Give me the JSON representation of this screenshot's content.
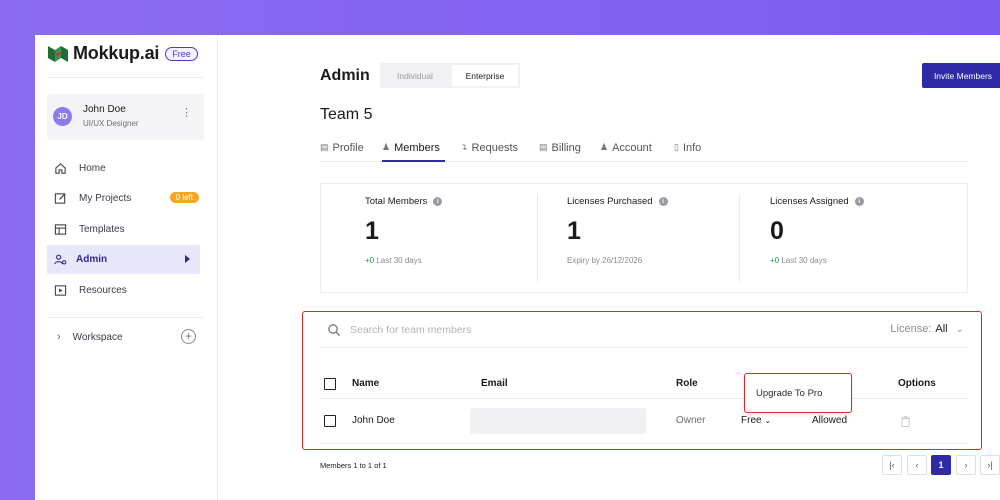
{
  "app": {
    "logo_text": "Mokkup.ai",
    "plan_badge": "Free"
  },
  "user": {
    "initials": "JD",
    "name": "John Doe",
    "role": "UI/UX Designer",
    "menu_icon": "kebab-icon"
  },
  "sidebar": {
    "items": [
      {
        "label": "Home",
        "icon": "home-icon"
      },
      {
        "label": "My Projects",
        "icon": "edit-icon",
        "badge": "0 left"
      },
      {
        "label": "Templates",
        "icon": "template-icon"
      },
      {
        "label": "Admin",
        "icon": "admin-icon",
        "active": true
      },
      {
        "label": "Resources",
        "icon": "play-box-icon"
      }
    ],
    "workspace_label": "Workspace"
  },
  "header": {
    "title": "Admin",
    "segments": [
      "Individual",
      "Enterprise"
    ],
    "selected_segment": "Enterprise",
    "invite_label": "Invite Members"
  },
  "team": {
    "title": "Team 5"
  },
  "tabs": [
    {
      "label": "Profile",
      "icon": "profile-icon"
    },
    {
      "label": "Members",
      "icon": "members-icon",
      "active": true
    },
    {
      "label": "Requests",
      "icon": "requests-icon"
    },
    {
      "label": "Billing",
      "icon": "billing-icon"
    },
    {
      "label": "Account",
      "icon": "account-icon"
    },
    {
      "label": "Info",
      "icon": "info-icon"
    }
  ],
  "stats": [
    {
      "label": "Total Members",
      "value": "1",
      "sub_pos": "+0",
      "sub": " Last 30 days"
    },
    {
      "label": "Licenses Purchased",
      "value": "1",
      "sub_pos": "",
      "sub": "Expiry by 26/12/2026"
    },
    {
      "label": "Licenses Assigned",
      "value": "0",
      "sub_pos": "+0",
      "sub": " Last 30 days"
    }
  ],
  "members_table": {
    "search_placeholder": "Search for team members",
    "license_filter_label": "License:",
    "license_filter_value": "All",
    "columns": [
      "Name",
      "Email",
      "Role",
      "Options"
    ],
    "rows": [
      {
        "name": "John Doe",
        "email": "",
        "role": "Owner",
        "license": "Free",
        "access": "Allowed"
      }
    ],
    "popover_option": "Upgrade To Pro"
  },
  "pagination": {
    "summary": "Members 1 to 1 of 1",
    "current_page": "1"
  },
  "colors": {
    "accent": "#2f2aa6",
    "highlight_border": "#e0262a",
    "badge": "#f5a623",
    "positive": "#1a9a4a"
  }
}
